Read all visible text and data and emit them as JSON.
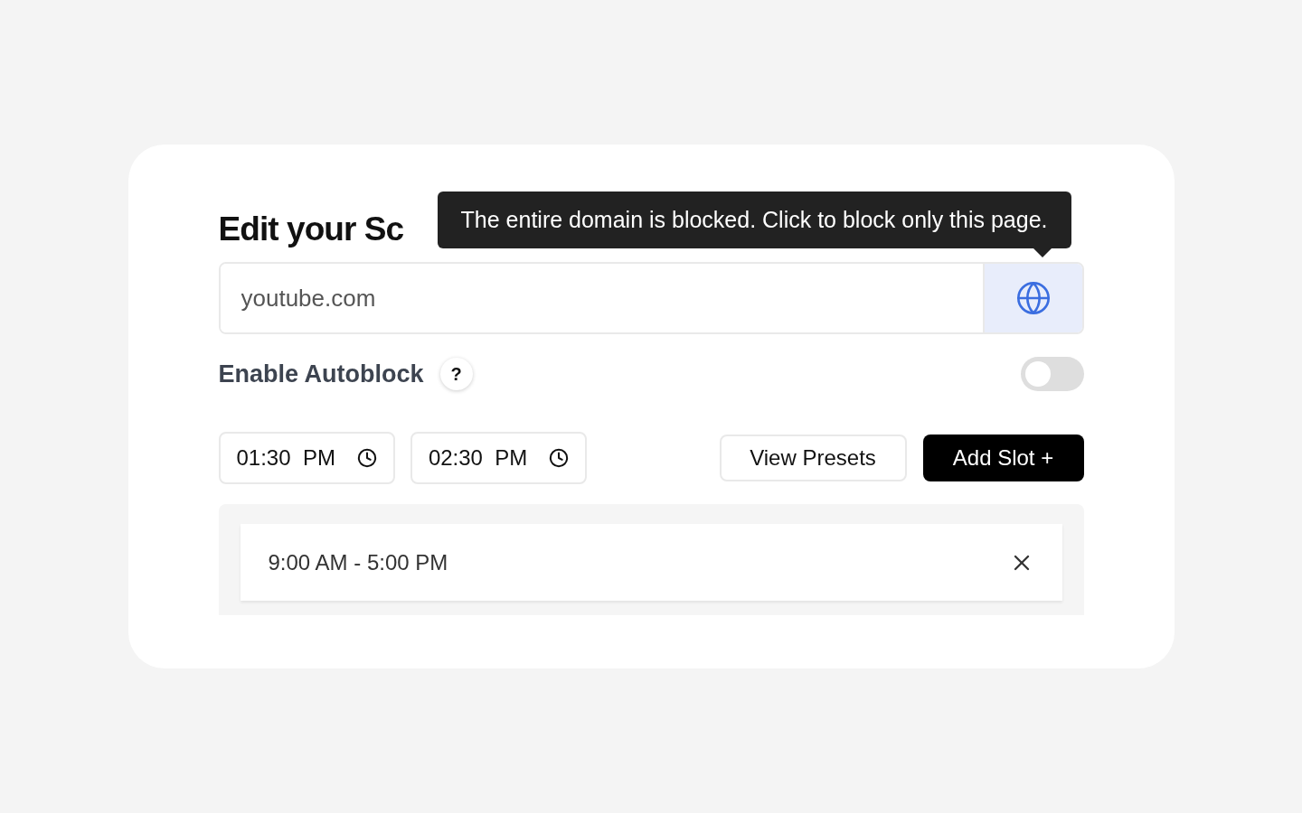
{
  "title": "Edit your Sc",
  "tooltip": "The entire domain is blocked. Click to block only this page.",
  "domain_field": {
    "value": "youtube.com"
  },
  "autoblock": {
    "label": "Enable Autoblock",
    "help": "?",
    "on": false
  },
  "times": [
    {
      "value": "01:30  PM"
    },
    {
      "value": "02:30  PM"
    }
  ],
  "buttons": [
    {
      "label": "View Presets",
      "kind": "secondary"
    },
    {
      "label": "Add Slot +",
      "kind": "primary"
    }
  ],
  "slots": [
    {
      "label": "9:00 AM - 5:00 PM"
    }
  ]
}
